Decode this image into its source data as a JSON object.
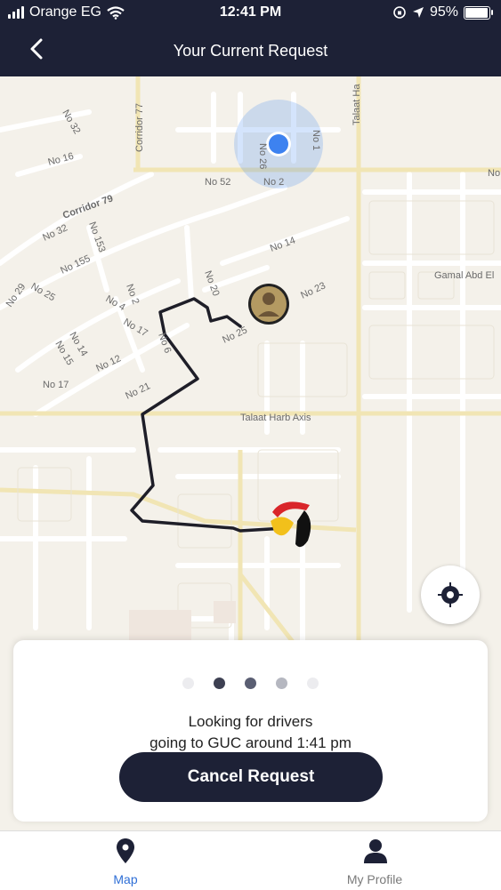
{
  "status_bar": {
    "carrier": "Orange EG",
    "time": "12:41 PM",
    "battery": "95%",
    "battery_level": 0.95
  },
  "header": {
    "title": "Your Current Request"
  },
  "map": {
    "street_labels": [
      "No 32",
      "No 16",
      "Corridor 77",
      "No 26",
      "No 1",
      "Talaat Ha",
      "No 52",
      "No 2",
      "No",
      "Corridor 79",
      "No 32",
      "No 153",
      "No 155",
      "No 14",
      "Gamal Abd El",
      "No 29",
      "No 25",
      "No 2",
      "No 20",
      "No 23",
      "No 4",
      "No 17",
      "No 25",
      "No 6",
      "No 14",
      "No 15",
      "No 12",
      "No 21",
      "No 17",
      "Talaat Harb Axis"
    ]
  },
  "request_card": {
    "progress_dots": [
      {
        "color": "#ececef"
      },
      {
        "color": "#3d4052"
      },
      {
        "color": "#5a5e72"
      },
      {
        "color": "#b5b7c0"
      },
      {
        "color": "#ececef"
      }
    ],
    "message_line1": "Looking for drivers",
    "message_line2": "going to GUC around 1:41 pm",
    "cancel_label": "Cancel Request"
  },
  "tab_bar": {
    "tabs": [
      {
        "label": "Map",
        "icon": "map-pin-icon",
        "active": true
      },
      {
        "label": "My Profile",
        "icon": "profile-icon",
        "active": false
      }
    ]
  },
  "colors": {
    "header_bg": "#1d2136",
    "accent": "#1d2136",
    "active_tab": "#2f6fd6",
    "inactive_tab": "#7a7a7a",
    "location_dot": "#3d82f0"
  }
}
